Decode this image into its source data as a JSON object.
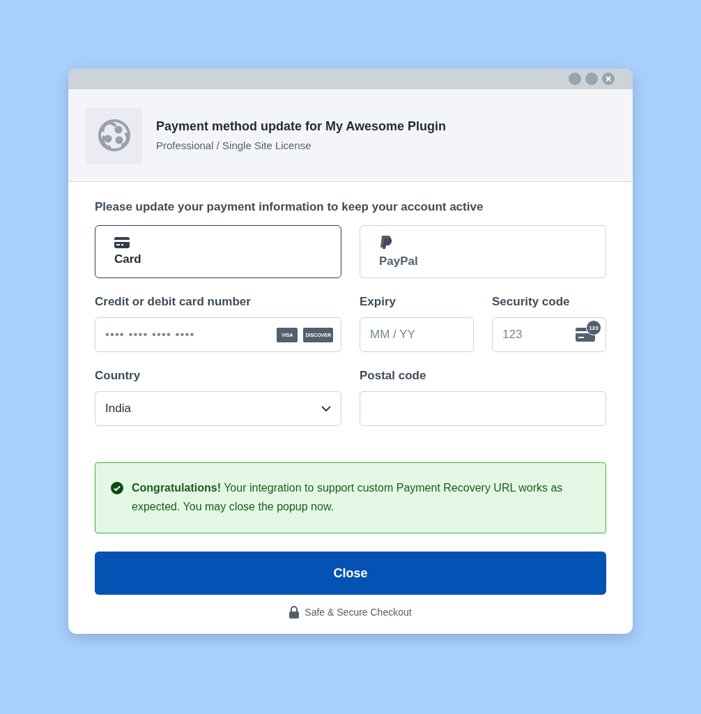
{
  "window": {
    "controls": [
      {
        "kind": "dot"
      },
      {
        "kind": "dot"
      },
      {
        "kind": "close"
      }
    ]
  },
  "header": {
    "title": "Payment method update for My Awesome Plugin",
    "subtitle": "Professional / Single Site License"
  },
  "prompt": "Please update your payment information to keep your account active",
  "methods": [
    {
      "kind": "card",
      "label": "Card",
      "selected": true
    },
    {
      "kind": "paypal",
      "label": "PayPal",
      "selected": false
    }
  ],
  "card_number": {
    "label": "Credit or debit card number",
    "placeholder": "•••• •••• •••• ••••",
    "brands": [
      "VISA",
      "DISCOVER"
    ]
  },
  "expiry": {
    "label": "Expiry",
    "placeholder": "MM / YY"
  },
  "security_code": {
    "label": "Security code",
    "placeholder": "123",
    "icon_badge": "123"
  },
  "country": {
    "label": "Country",
    "value": "India"
  },
  "postal_code": {
    "label": "Postal code"
  },
  "notice": {
    "text": "**Congratulations!** Your integration to support custom Payment Recovery URL works as expected. You may close the popup now."
  },
  "close_button": "Close",
  "footer": "Safe & Secure Checkout"
}
